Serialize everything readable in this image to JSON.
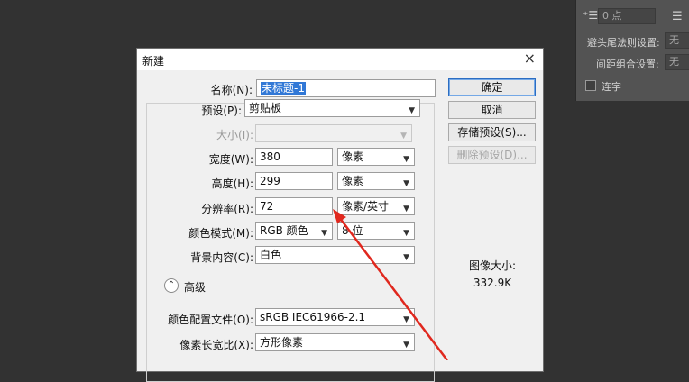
{
  "ps_panel": {
    "top_field": "0 点",
    "avoid_label": "避头尾法则设置:",
    "avoid_value": "无",
    "spacing_label": "间距组合设置:",
    "spacing_value": "无",
    "ligature_label": "连字"
  },
  "dialog": {
    "title": "新建",
    "name_label": "名称(N):",
    "name_value": "未标题-1",
    "preset_label": "预设(P):",
    "preset_value": "剪贴板",
    "size_label": "大小(I):",
    "width_label": "宽度(W):",
    "width_value": "380",
    "width_unit": "像素",
    "height_label": "高度(H):",
    "height_value": "299",
    "height_unit": "像素",
    "resolution_label": "分辨率(R):",
    "resolution_value": "72",
    "resolution_unit": "像素/英寸",
    "color_mode_label": "颜色模式(M):",
    "color_mode_value": "RGB 颜色",
    "bit_depth_value": "8 位",
    "background_label": "背景内容(C):",
    "background_value": "白色",
    "advanced_label": "高级",
    "color_profile_label": "颜色配置文件(O):",
    "color_profile_value": "sRGB IEC61966-2.1",
    "pixel_aspect_label": "像素长宽比(X):",
    "pixel_aspect_value": "方形像素",
    "image_size_label": "图像大小:",
    "image_size_value": "332.9K"
  },
  "buttons": {
    "ok": "确定",
    "cancel": "取消",
    "save_preset": "存储预设(S)...",
    "delete_preset": "删除预设(D)..."
  },
  "icons": {
    "close": "close-icon",
    "caret": "chevron-down-icon",
    "advanced_toggle": "double-chevron-up-icon"
  },
  "colors": {
    "annotation_arrow": "#e0281e",
    "selection": "#3178d6",
    "ps_background": "#323232",
    "ps_panel": "#535353"
  }
}
